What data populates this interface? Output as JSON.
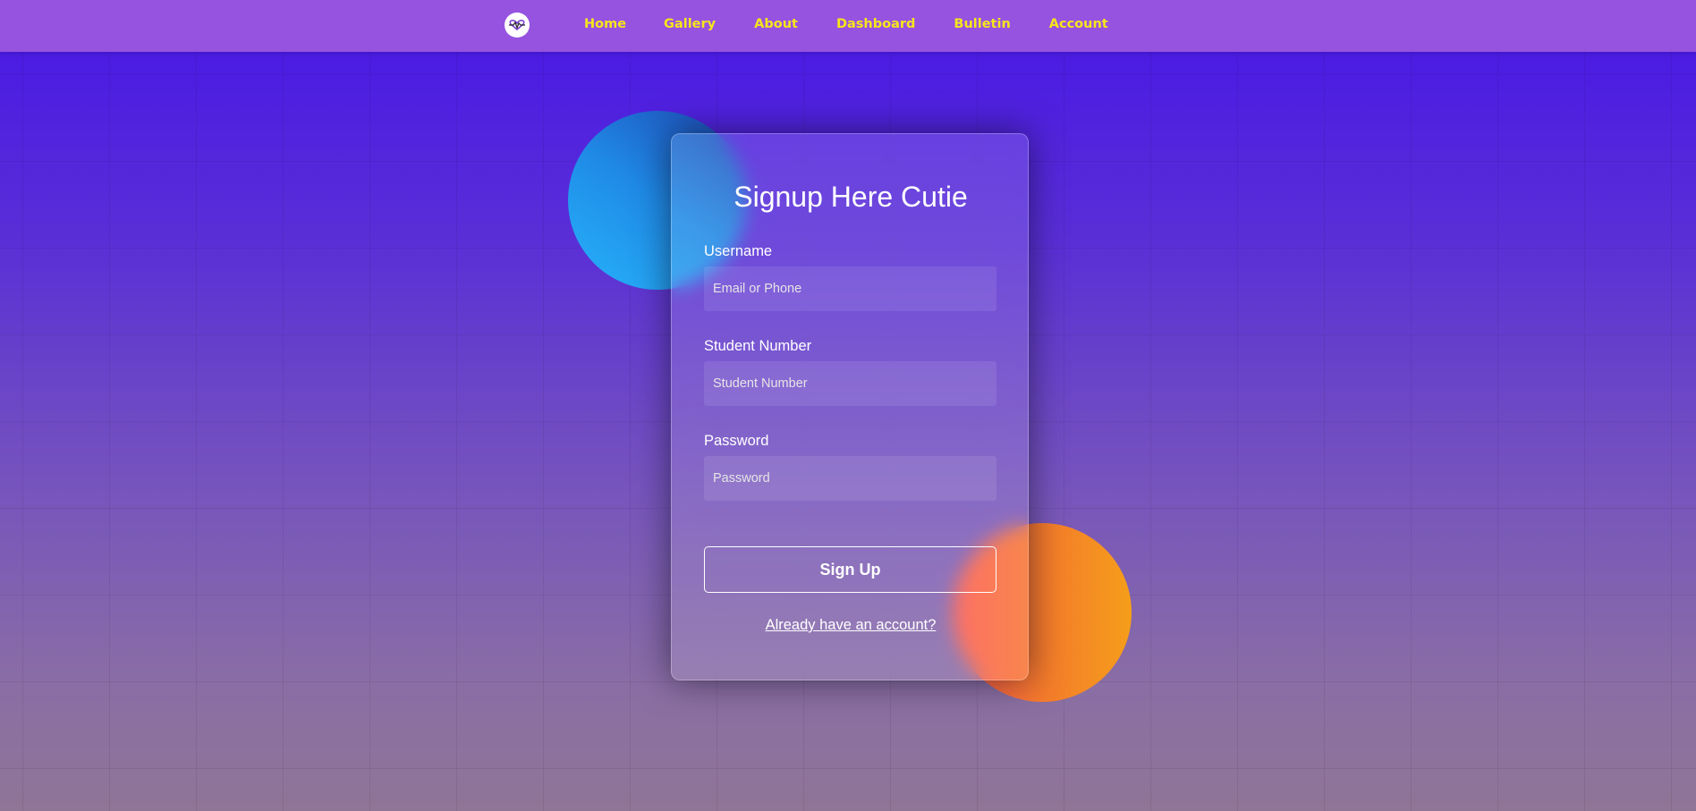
{
  "nav": {
    "logo_icon": "heart-logo-icon",
    "links": [
      {
        "label": "Home"
      },
      {
        "label": "Gallery"
      },
      {
        "label": "About"
      },
      {
        "label": "Dashboard"
      },
      {
        "label": "Bulletin"
      },
      {
        "label": "Account"
      }
    ]
  },
  "form": {
    "title": "Signup Here Cutie",
    "username": {
      "label": "Username",
      "placeholder": "Email or Phone",
      "value": ""
    },
    "student_number": {
      "label": "Student Number",
      "placeholder": "Student Number",
      "value": ""
    },
    "password": {
      "label": "Password",
      "placeholder": "Password",
      "value": ""
    },
    "submit_label": "Sign Up",
    "login_link": "Already have an account?"
  },
  "colors": {
    "nav_background": "#9653df",
    "nav_link": "#f6e51c",
    "background_top": "#4716e6",
    "background_bottom": "#8f7596",
    "circle_blue": "#27b3fb",
    "circle_orange": "#f47a2c"
  }
}
